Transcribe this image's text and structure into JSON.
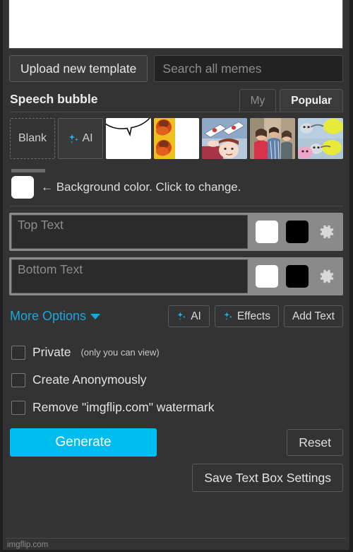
{
  "canvas": {
    "background_color": "#ffffff"
  },
  "toolbar": {
    "upload_label": "Upload new template",
    "search_placeholder": "Search all memes"
  },
  "section": {
    "title": "Speech bubble",
    "tabs": [
      {
        "label": "My",
        "active": false
      },
      {
        "label": "Popular",
        "active": true
      }
    ]
  },
  "templates": [
    {
      "name": "blank",
      "label": "Blank"
    },
    {
      "name": "ai",
      "label": "AI",
      "icon": "sparkle-icon"
    },
    {
      "name": "speech-bubble",
      "label": ""
    },
    {
      "name": "drake-hotline-bling",
      "label": ""
    },
    {
      "name": "is-this-a-pigeon",
      "label": ""
    },
    {
      "name": "distracted-boyfriend",
      "label": ""
    },
    {
      "name": "running-away-balloon",
      "label": ""
    }
  ],
  "background_color_row": {
    "swatch_color": "#ffffff",
    "label": "← Background color. Click to change."
  },
  "text_boxes": [
    {
      "placeholder": "Top Text",
      "value": "",
      "fill_color": "#ffffff",
      "outline_color": "#000000",
      "settings_icon": "gear-icon"
    },
    {
      "placeholder": "Bottom Text",
      "value": "",
      "fill_color": "#ffffff",
      "outline_color": "#000000",
      "settings_icon": "gear-icon"
    }
  ],
  "options_row": {
    "more_options_label": "More Options",
    "buttons": [
      {
        "label": "AI",
        "icon": "sparkle-icon"
      },
      {
        "label": "Effects",
        "icon": "sparkle-icon"
      },
      {
        "label": "Add Text",
        "icon": ""
      }
    ]
  },
  "checkboxes": [
    {
      "label": "Private",
      "sub_label": "(only you can view)",
      "checked": false
    },
    {
      "label": "Create Anonymously",
      "sub_label": "",
      "checked": false
    },
    {
      "label": "Remove \"imgflip.com\" watermark",
      "sub_label": "",
      "checked": false
    }
  ],
  "footer": {
    "generate_label": "Generate",
    "reset_label": "Reset",
    "save_label": "Save Text Box Settings",
    "watermark": "imgflip.com"
  },
  "colors": {
    "accent": "#00bdf0",
    "link": "#18a7e0",
    "page_bg": "#333333"
  }
}
